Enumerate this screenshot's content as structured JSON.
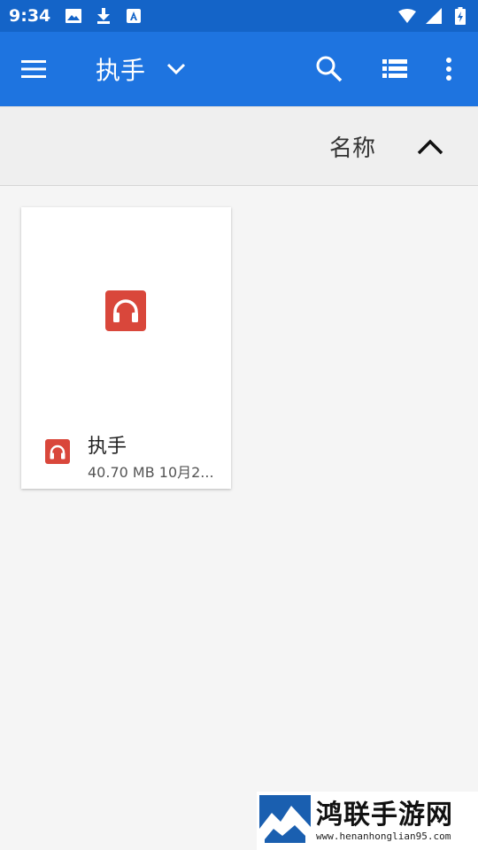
{
  "status_bar": {
    "time": "9:34",
    "left_icons": [
      "image-icon",
      "download-icon",
      "font-icon"
    ],
    "right_icons": [
      "wifi-icon",
      "signal-icon",
      "battery-icon"
    ]
  },
  "toolbar": {
    "title": "执手",
    "icons": [
      "menu-icon",
      "chevron-down-icon",
      "search-icon",
      "list-view-icon",
      "more-vert-icon"
    ]
  },
  "sort": {
    "label": "名称",
    "direction_icon": "chevron-up-icon"
  },
  "files": [
    {
      "name": "执手",
      "meta": "40.70 MB 10月2...",
      "icon": "headphones-icon",
      "icon_color": "#d9473b"
    }
  ],
  "watermark": {
    "title": "鸿联手游网",
    "url": "www.henanhonglian95.com"
  },
  "colors": {
    "status_bar": "#1464c8",
    "toolbar": "#1e74e0",
    "background": "#f5f5f5"
  }
}
